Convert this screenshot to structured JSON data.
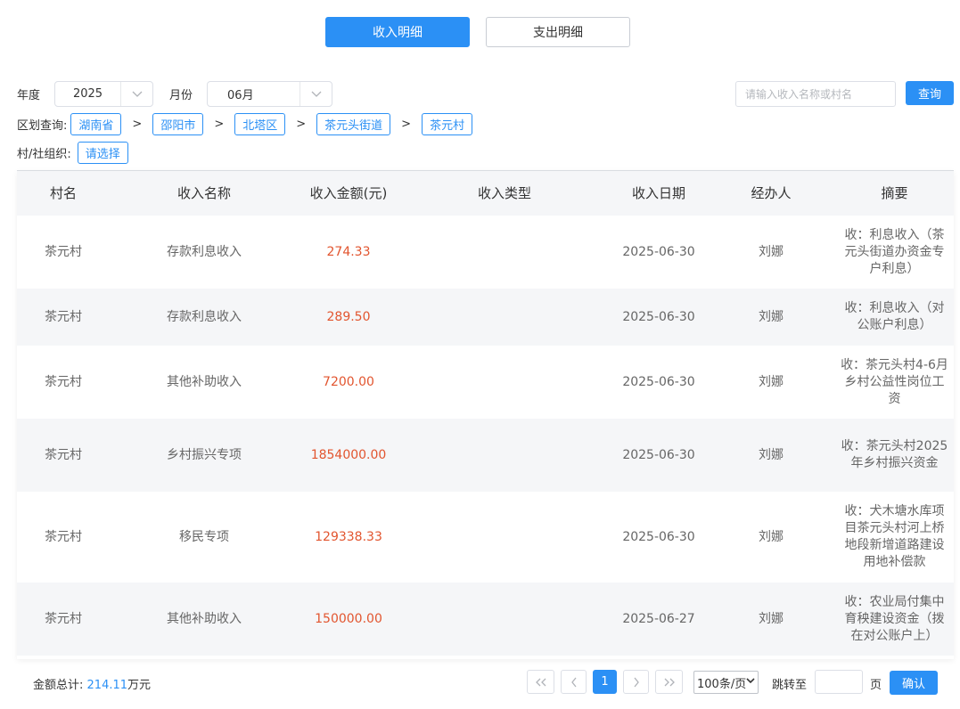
{
  "tabs": [
    {
      "label": "收入明细",
      "active": true
    },
    {
      "label": "支出明细",
      "active": false
    }
  ],
  "filters": {
    "year_label": "年度",
    "year_value": "2025",
    "month_label": "月份",
    "month_value": "06月",
    "search_placeholder": "请输入收入名称或村名",
    "search_button": "查询",
    "region_label": "区划查询:",
    "region_path": [
      "湖南省",
      "邵阳市",
      "北塔区",
      "茶元头街道",
      "茶元村"
    ],
    "region_sep": ">",
    "org_label": "村/社组织:",
    "org_button": "请选择"
  },
  "table": {
    "headers": [
      "村名",
      "收入名称",
      "收入金额(元)",
      "收入类型",
      "收入日期",
      "经办人",
      "摘要"
    ],
    "rows": [
      {
        "village": "茶元村",
        "name": "存款利息收入",
        "amount": "274.33",
        "type": "",
        "date": "2025-06-30",
        "handler": "刘娜",
        "summary": "收：利息收入（茶元头街道办资金专户利息）"
      },
      {
        "village": "茶元村",
        "name": "存款利息收入",
        "amount": "289.50",
        "type": "",
        "date": "2025-06-30",
        "handler": "刘娜",
        "summary": "收：利息收入（对公账户利息）"
      },
      {
        "village": "茶元村",
        "name": "其他补助收入",
        "amount": "7200.00",
        "type": "",
        "date": "2025-06-30",
        "handler": "刘娜",
        "summary": "收：茶元头村4-6月乡村公益性岗位工资"
      },
      {
        "village": "茶元村",
        "name": "乡村振兴专项",
        "amount": "1854000.00",
        "type": "",
        "date": "2025-06-30",
        "handler": "刘娜",
        "summary": "收：茶元头村2025年乡村振兴资金"
      },
      {
        "village": "茶元村",
        "name": "移民专项",
        "amount": "129338.33",
        "type": "",
        "date": "2025-06-30",
        "handler": "刘娜",
        "summary": "收：犬木塘水库项目茶元头村河上桥地段新增道路建设用地补偿款"
      },
      {
        "village": "茶元村",
        "name": "其他补助收入",
        "amount": "150000.00",
        "type": "",
        "date": "2025-06-27",
        "handler": "刘娜",
        "summary": "收：农业局付集中育秧建设资金（拨在对公账户上）"
      }
    ]
  },
  "footer": {
    "total_label": "金额总计:",
    "total_value": "214.11",
    "total_unit": "万元",
    "current_page": "1",
    "page_size": "100条/页",
    "jump_label": "跳转至",
    "page_unit": "页",
    "confirm": "确认"
  },
  "colors": {
    "accent": "#2b90f5",
    "amount": "#e2552f"
  }
}
